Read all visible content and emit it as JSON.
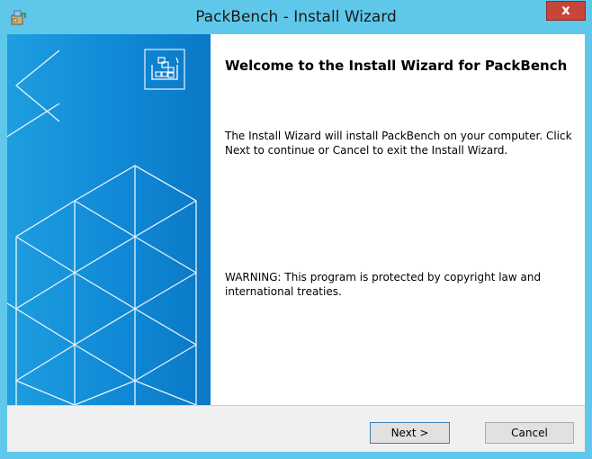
{
  "window": {
    "title": "PackBench - Install Wizard",
    "close_label": "x",
    "accent_color": "#5fc8ea",
    "icon": "installer-box-icon"
  },
  "banner": {
    "background_color": "#1089d6",
    "logo_icon": "package-boxes-icon"
  },
  "content": {
    "heading": "Welcome to the Install Wizard for PackBench",
    "intro": "The Install Wizard will install PackBench on your computer. Click Next to continue or Cancel to exit the Install Wizard.",
    "warning": "WARNING: This program is protected by copyright law and international treaties."
  },
  "footer": {
    "next_label": "Next >",
    "cancel_label": "Cancel"
  }
}
